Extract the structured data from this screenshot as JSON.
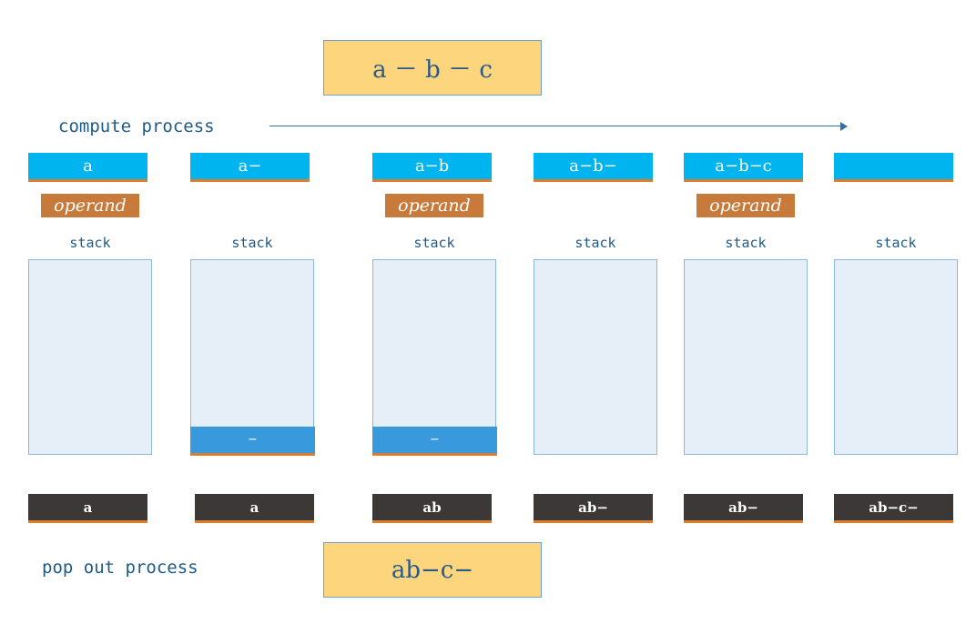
{
  "input_expression": "a － b － c",
  "compute_label": "compute process",
  "pop_label": "pop out process",
  "result": "ab−c−",
  "operand_label": "operand",
  "stack_label": "stack",
  "steps": [
    {
      "expr": "a",
      "operand": true,
      "stack": [],
      "output": "a"
    },
    {
      "expr": "a−",
      "operand": false,
      "stack": [
        "−"
      ],
      "output": "a"
    },
    {
      "expr": "a−b",
      "operand": true,
      "stack": [
        "−"
      ],
      "output": "ab"
    },
    {
      "expr": "a−b−",
      "operand": false,
      "stack": [],
      "output": "ab−"
    },
    {
      "expr": "a−b−c",
      "operand": true,
      "stack": [],
      "output": "ab−"
    },
    {
      "expr": "",
      "operand": false,
      "stack": [],
      "output": "ab−c−"
    }
  ],
  "colors": {
    "expr_bar": "#00b4ef",
    "operand_tag": "#c87a3a",
    "stack_bg": "#e6eef8",
    "stack_item": "#3899dd",
    "output_bar": "#3c3838",
    "highlight": "#fdd57c",
    "underline": "#e07b2a"
  }
}
